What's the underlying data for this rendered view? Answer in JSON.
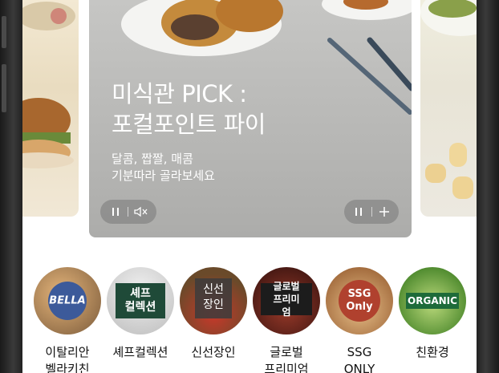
{
  "banner": {
    "headline": "미식관 PICK :\n포컬포인트 파이",
    "subline": "달콤, 짭짤, 매콤\n기분따라 골라보세요"
  },
  "categories": [
    {
      "label": "이탈리안\n벨라키친",
      "badge": "BELLA",
      "accent": "#3c5a9a"
    },
    {
      "label": "셰프컬렉션",
      "badge": "셰프\n컬렉션",
      "accent": "#1f4a38"
    },
    {
      "label": "신선장인",
      "badge": "신선\n장인",
      "accent": "#3a3a3a"
    },
    {
      "label": "글로벌\n프리미엄",
      "badge": "글로벌\n프리미엄",
      "accent": "#1c1c1c"
    },
    {
      "label": "SSG\nONLY",
      "badge": "SSG\nOnly",
      "accent": "#b0412e"
    },
    {
      "label": "친환경",
      "badge": "ORGANIC",
      "accent": "#1e6b3a"
    }
  ],
  "icons": {
    "pause": "pause-icon",
    "mute": "speaker-muted-icon",
    "add": "plus-icon"
  }
}
